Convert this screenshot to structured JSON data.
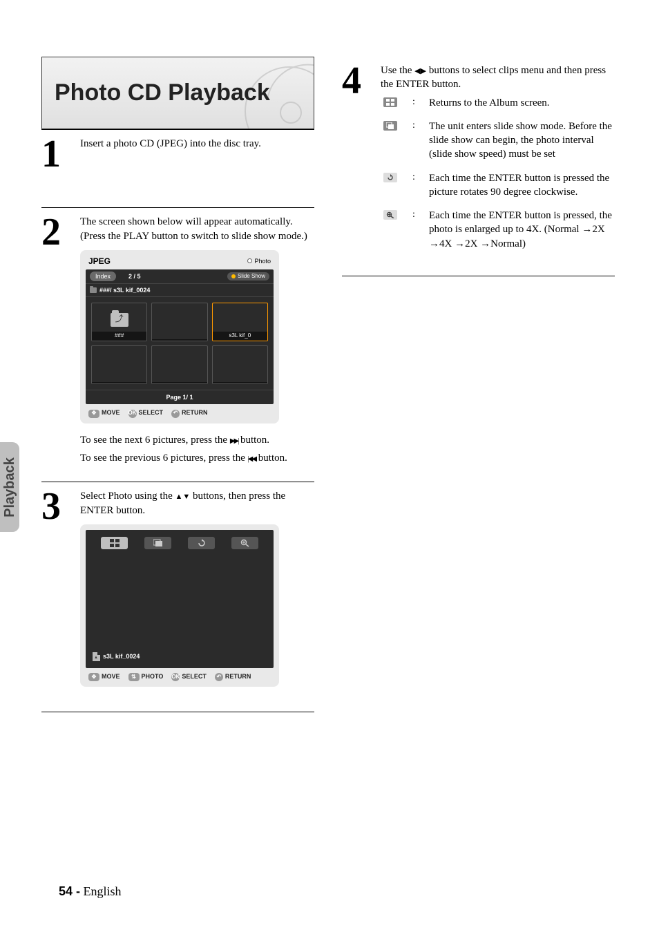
{
  "title": "Photo CD Playback",
  "side_tab": "Playback",
  "footer": {
    "page": "54 -",
    "lang": "English"
  },
  "steps": {
    "s1": {
      "num": "1",
      "text": "Insert a photo CD (JPEG) into the disc tray."
    },
    "s2": {
      "num": "2",
      "text": "The screen shown below will appear automatically. (Press the PLAY button to switch to slide show mode.)",
      "after1": "To see the next 6 pictures, press the",
      "after1b": "button.",
      "after2": "To see the previous 6 pictures, press the",
      "after2b": "button."
    },
    "s3": {
      "num": "3",
      "text_a": "Select Photo using the",
      "text_b": "buttons, then press the ENTER button."
    },
    "s4": {
      "num": "4",
      "text_a": "Use the",
      "text_b": "buttons to select clips menu and then press the ENTER button."
    }
  },
  "screenshot1": {
    "title": "JPEG",
    "photo_label": "Photo",
    "index_label": "Index",
    "index_count": "2 /     5",
    "slide_show": "Slide Show",
    "path": "###/ s3L kif_0024",
    "thumbs": [
      {
        "label": "###",
        "folder": true,
        "selected": false
      },
      {
        "label": "",
        "folder": false,
        "selected": false
      },
      {
        "label": "s3L kif_0",
        "folder": false,
        "selected": true
      },
      {
        "label": "",
        "folder": false,
        "selected": false
      },
      {
        "label": "",
        "folder": false,
        "selected": false
      },
      {
        "label": "",
        "folder": false,
        "selected": false
      }
    ],
    "page": "Page 1/ 1",
    "footer": {
      "move": "MOVE",
      "select": "SELECT",
      "return": "RETURN"
    }
  },
  "screenshot2": {
    "file": "s3L kif_0024",
    "footer": {
      "move": "MOVE",
      "photo": "PHOTO",
      "select": "SELECT",
      "return": "RETURN"
    }
  },
  "icon_list": [
    {
      "desc": "Returns to the Album screen."
    },
    {
      "desc": "The unit enters slide show mode. Before the slide show can begin, the photo interval (slide show speed) must be set"
    },
    {
      "desc": "Each time the ENTER button is pressed the picture rotates 90 degree clockwise."
    },
    {
      "desc": "Each time the ENTER button is pressed, the photo is enlarged up to 4X. (Normal →2X →4X →2X →Normal)"
    }
  ]
}
